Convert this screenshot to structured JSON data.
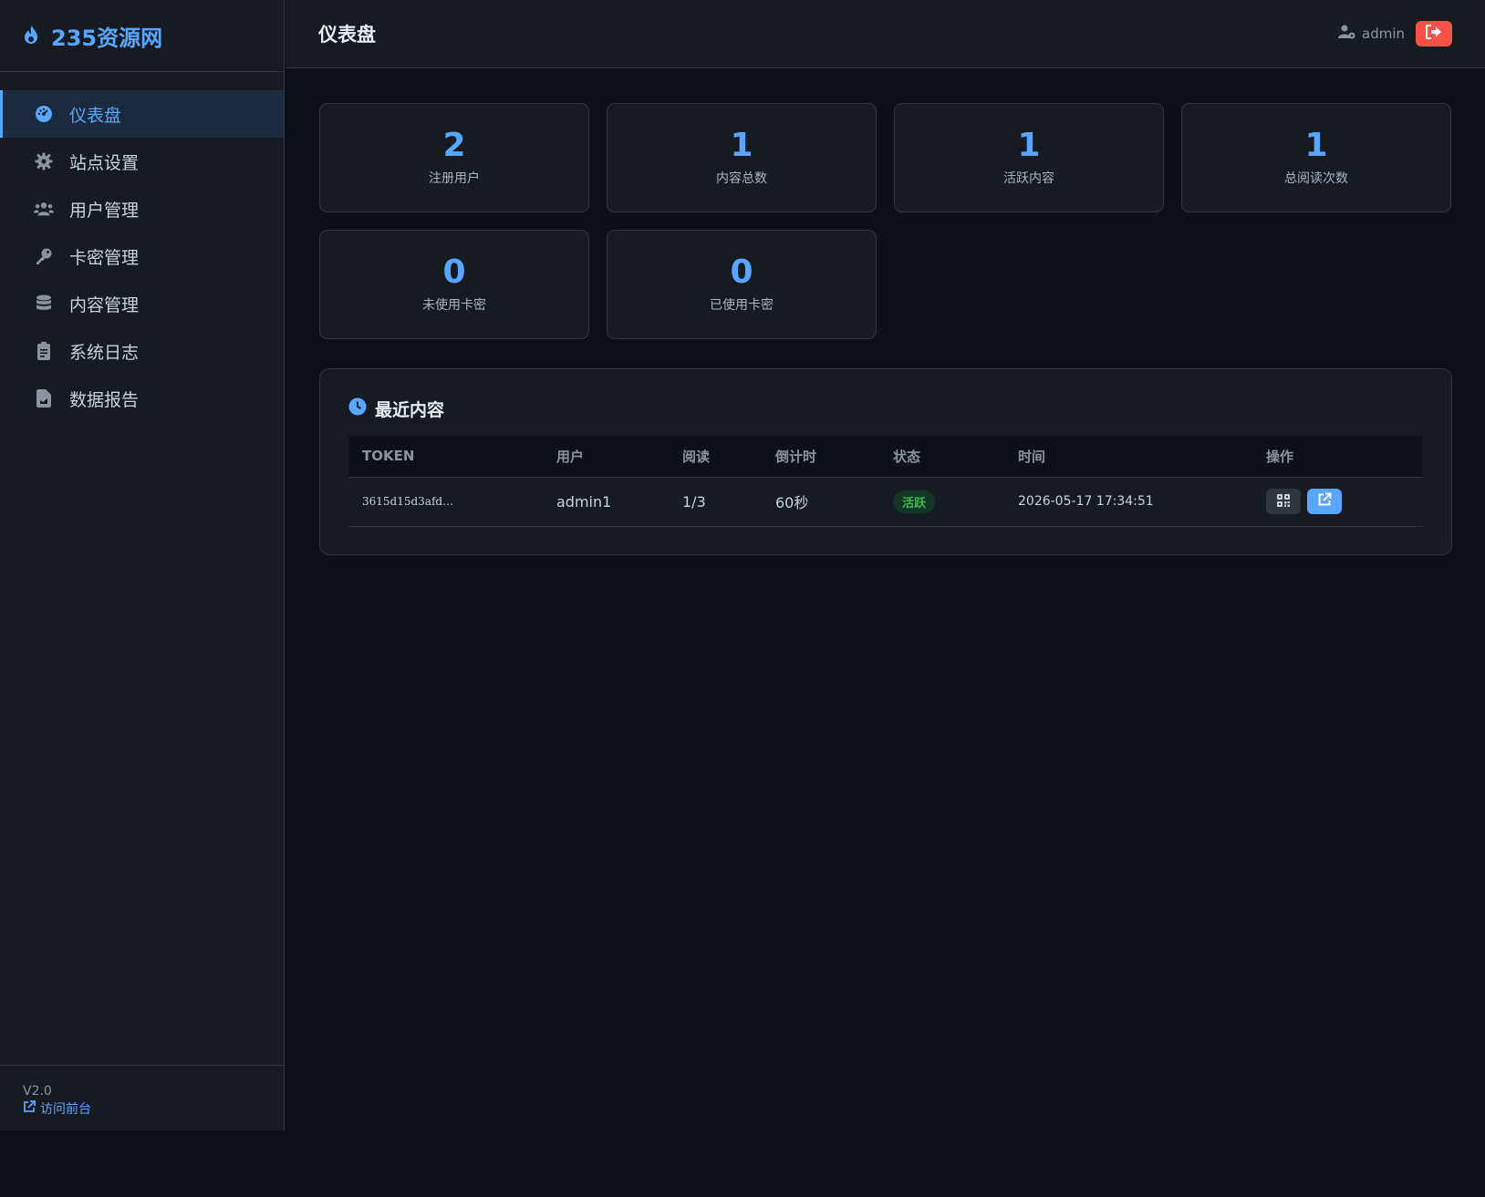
{
  "brand": {
    "name": "235资源网",
    "icon": "fire-icon"
  },
  "sidebar": {
    "items": [
      {
        "label": "仪表盘",
        "icon": "dashboard-icon",
        "active": true
      },
      {
        "label": "站点设置",
        "icon": "gear-icon",
        "active": false
      },
      {
        "label": "用户管理",
        "icon": "users-icon",
        "active": false
      },
      {
        "label": "卡密管理",
        "icon": "key-icon",
        "active": false
      },
      {
        "label": "内容管理",
        "icon": "database-icon",
        "active": false
      },
      {
        "label": "系统日志",
        "icon": "clipboard-icon",
        "active": false
      },
      {
        "label": "数据报告",
        "icon": "file-chart-icon",
        "active": false
      }
    ],
    "footer": {
      "version": "V2.0",
      "front_link": "访问前台"
    }
  },
  "header": {
    "title": "仪表盘",
    "username": "admin"
  },
  "stats": [
    {
      "value": "2",
      "label": "注册用户"
    },
    {
      "value": "1",
      "label": "内容总数"
    },
    {
      "value": "1",
      "label": "活跃内容"
    },
    {
      "value": "1",
      "label": "总阅读次数"
    },
    {
      "value": "0",
      "label": "未使用卡密"
    },
    {
      "value": "0",
      "label": "已使用卡密"
    }
  ],
  "recent": {
    "title": "最近内容",
    "columns": [
      "TOKEN",
      "用户",
      "阅读",
      "倒计时",
      "状态",
      "时间",
      "操作"
    ],
    "rows": [
      {
        "token": "3615d15d3afd…",
        "user": "admin1",
        "reads": "1/3",
        "countdown": "60秒",
        "status": "活跃",
        "time": "2026-05-17 17:34:51"
      }
    ]
  },
  "colors": {
    "accent": "#58a6ff",
    "danger": "#f85149",
    "success": "#3fb950",
    "background": "#0d1117",
    "panel": "#161b22"
  }
}
